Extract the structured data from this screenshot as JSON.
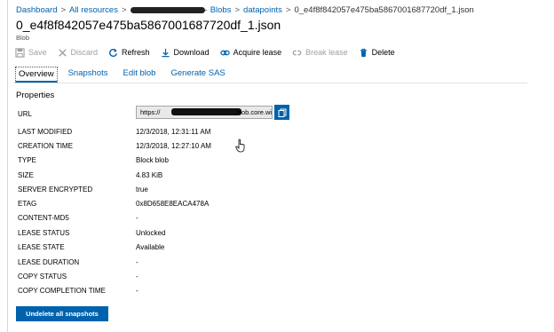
{
  "breadcrumb": {
    "items": [
      "Dashboard",
      "All resources",
      "Blobs",
      "datapoints"
    ],
    "redacted_suffix": "-",
    "current": "0_e4f8f842057e475ba5867001687720df_1.json"
  },
  "header": {
    "title": "0_e4f8f842057e475ba5867001687720df_1.json",
    "subtitle": "Blob"
  },
  "toolbar": {
    "save": "Save",
    "discard": "Discard",
    "refresh": "Refresh",
    "download": "Download",
    "acquire_lease": "Acquire lease",
    "break_lease": "Break lease",
    "delete": "Delete"
  },
  "tabs": [
    "Overview",
    "Snapshots",
    "Edit blob",
    "Generate SAS"
  ],
  "properties": {
    "heading": "Properties",
    "url_label": "URL",
    "url_prefix": "https://",
    "url_suffix": ".blob.core.wi...",
    "rows": [
      {
        "key": "LAST MODIFIED",
        "value": "12/3/2018, 12:31:11 AM"
      },
      {
        "key": "CREATION TIME",
        "value": "12/3/2018, 12:27:10 AM"
      },
      {
        "key": "TYPE",
        "value": "Block blob"
      },
      {
        "key": "SIZE",
        "value": "4.83 KiB"
      },
      {
        "key": "SERVER ENCRYPTED",
        "value": "true"
      },
      {
        "key": "ETAG",
        "value": "0x8D658E8EACA478A"
      },
      {
        "key": "CONTENT-MD5",
        "value": "-"
      },
      {
        "key": "LEASE STATUS",
        "value": "Unlocked"
      },
      {
        "key": "LEASE STATE",
        "value": "Available"
      },
      {
        "key": "LEASE DURATION",
        "value": "-"
      },
      {
        "key": "COPY STATUS",
        "value": "-"
      },
      {
        "key": "COPY COMPLETION TIME",
        "value": "-"
      }
    ]
  },
  "actions": {
    "undelete": "Undelete all snapshots"
  },
  "colors": {
    "accent": "#0062ad",
    "disabled": "#a0a0a0"
  }
}
